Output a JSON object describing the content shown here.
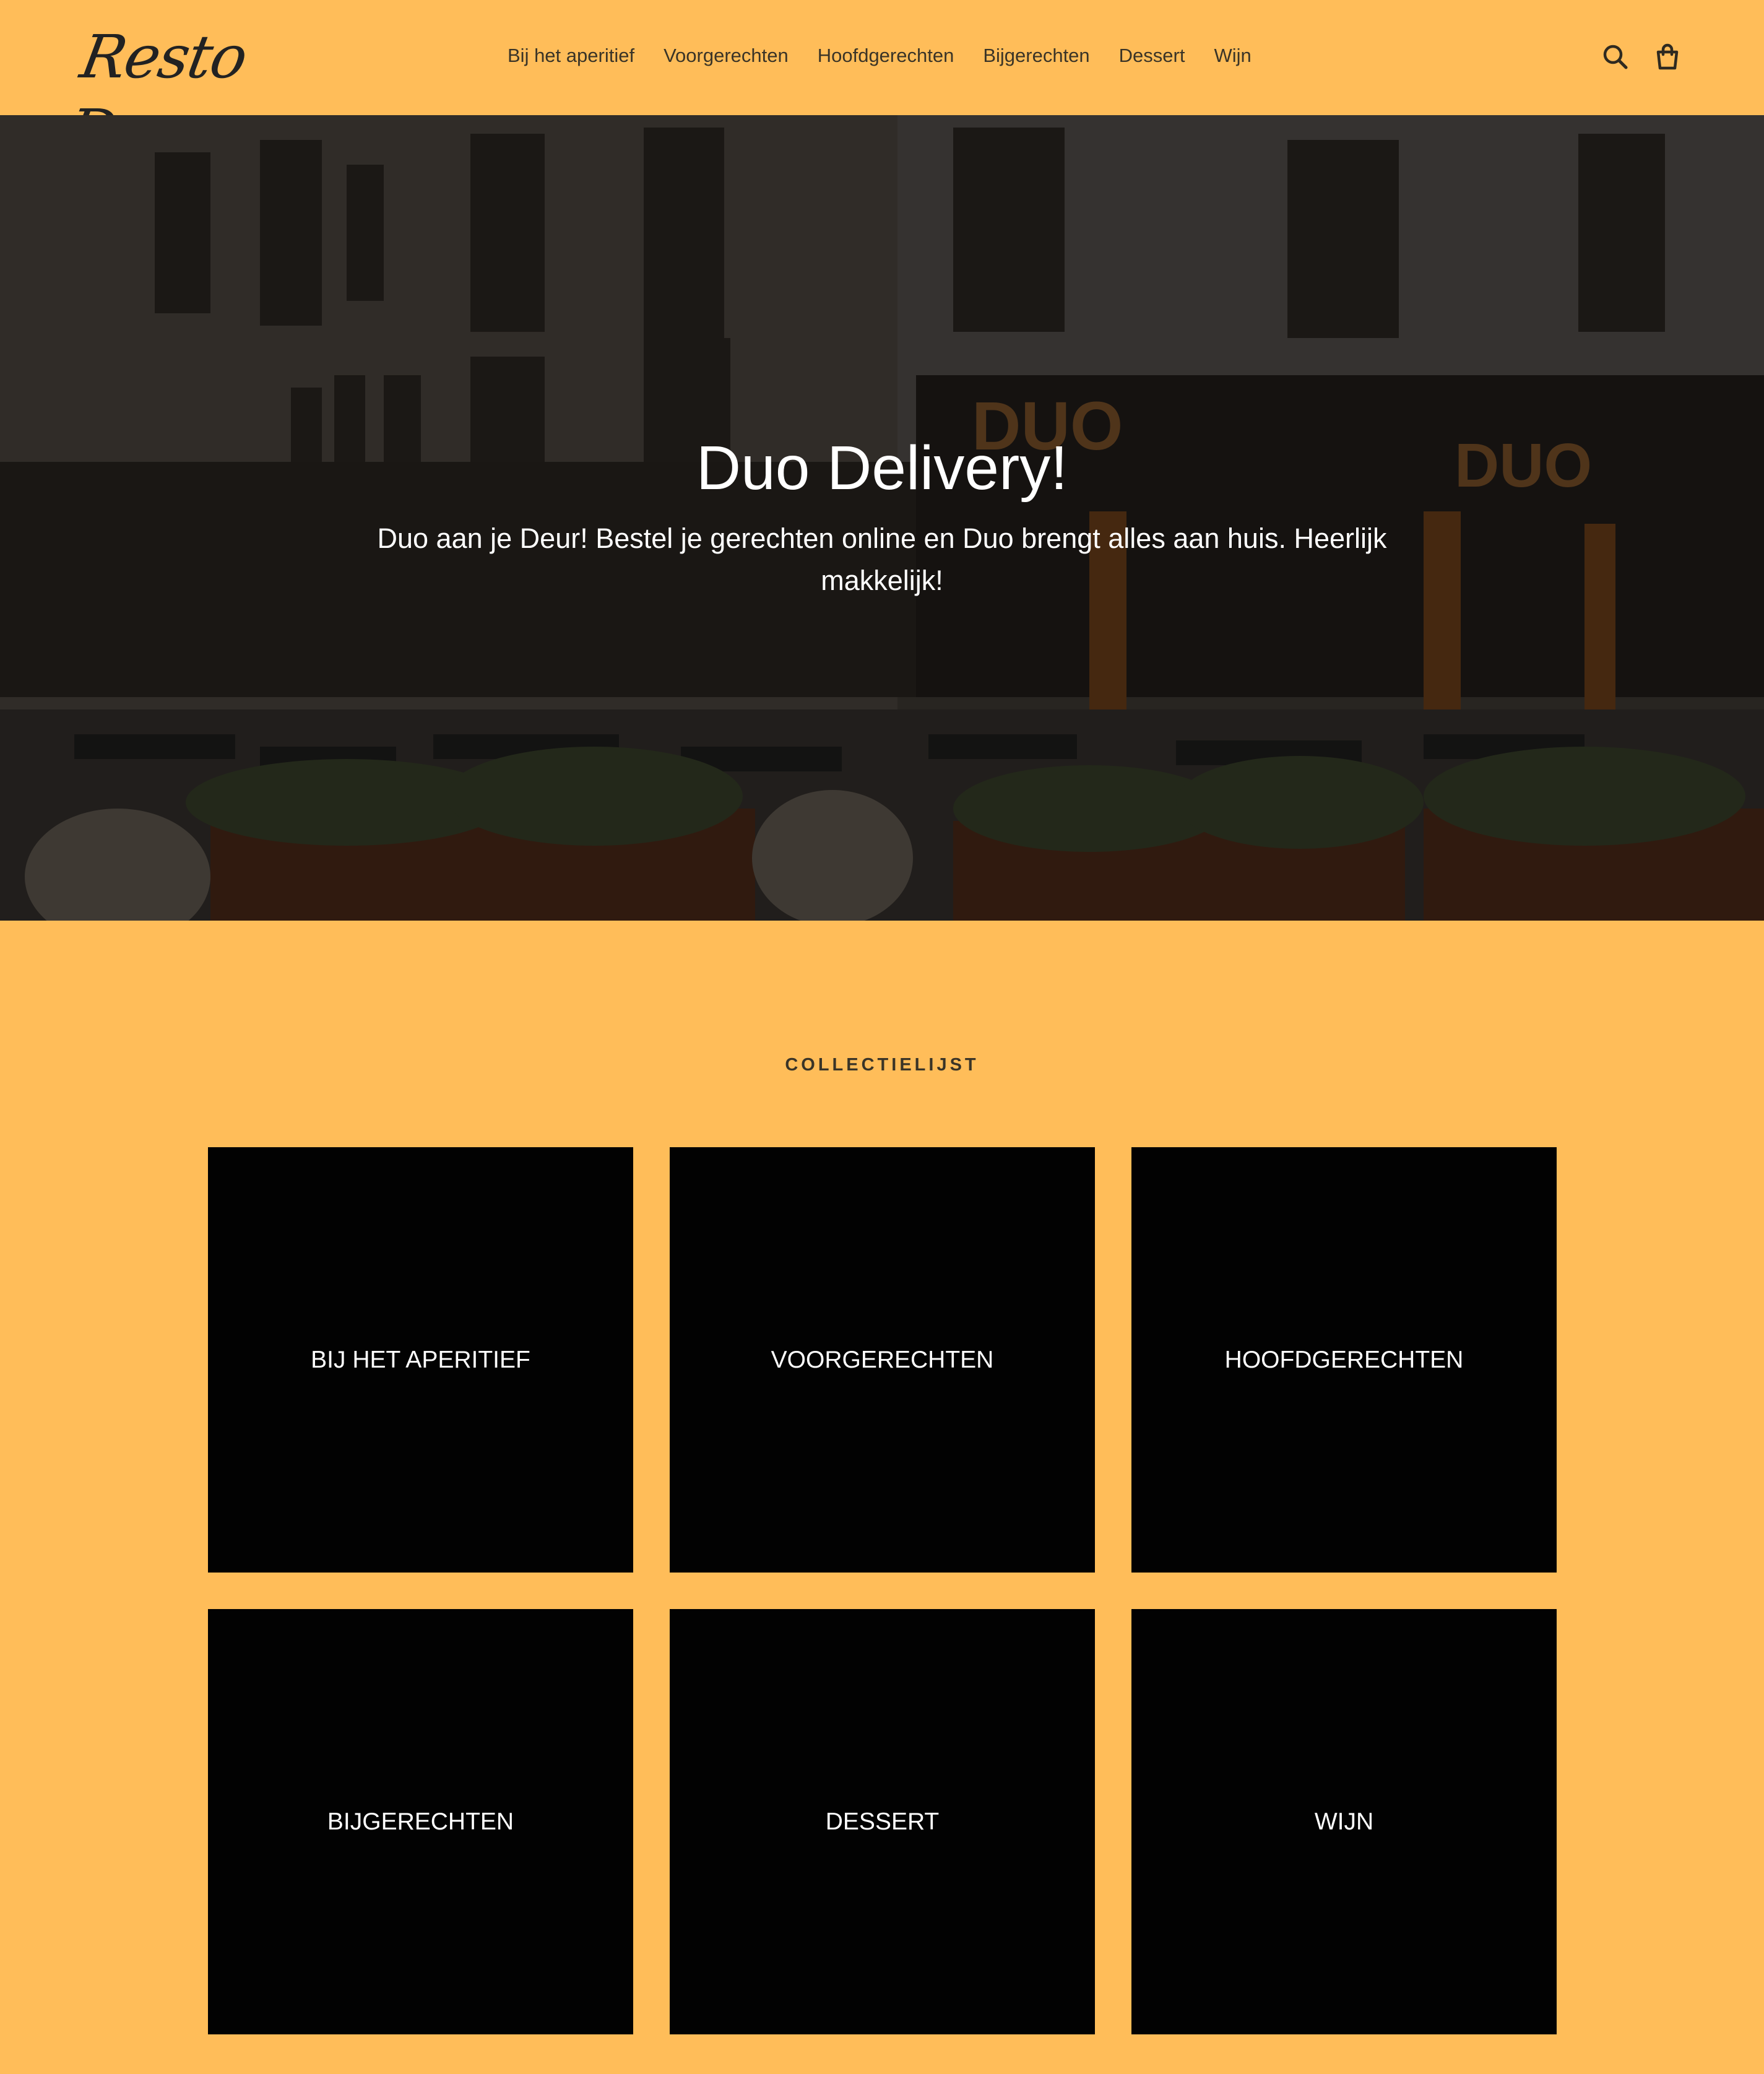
{
  "header": {
    "logo_text": "Resto Duo",
    "nav": [
      {
        "label": "Bij het aperitief"
      },
      {
        "label": "Voorgerechten"
      },
      {
        "label": "Hoofdgerechten"
      },
      {
        "label": "Bijgerechten"
      },
      {
        "label": "Dessert"
      },
      {
        "label": "Wijn"
      }
    ],
    "icons": {
      "search": "search-icon",
      "cart": "cart-icon"
    }
  },
  "hero": {
    "title": "Duo Delivery!",
    "text": "Duo aan je Deur! Bestel je gerechten online en Duo brengt alles aan huis. Heerlijk makkelijk!"
  },
  "collections": {
    "title": "COLLECTIELIJST",
    "items": [
      {
        "label": "BIJ HET APERITIEF"
      },
      {
        "label": "VOORGERECHTEN"
      },
      {
        "label": "HOOFDGERECHTEN"
      },
      {
        "label": "BIJGERECHTEN"
      },
      {
        "label": "DESSERT"
      },
      {
        "label": "WIJN"
      }
    ]
  },
  "colors": {
    "background": "#ffbd59",
    "tile": "#020202",
    "text": "#2f2a20"
  }
}
